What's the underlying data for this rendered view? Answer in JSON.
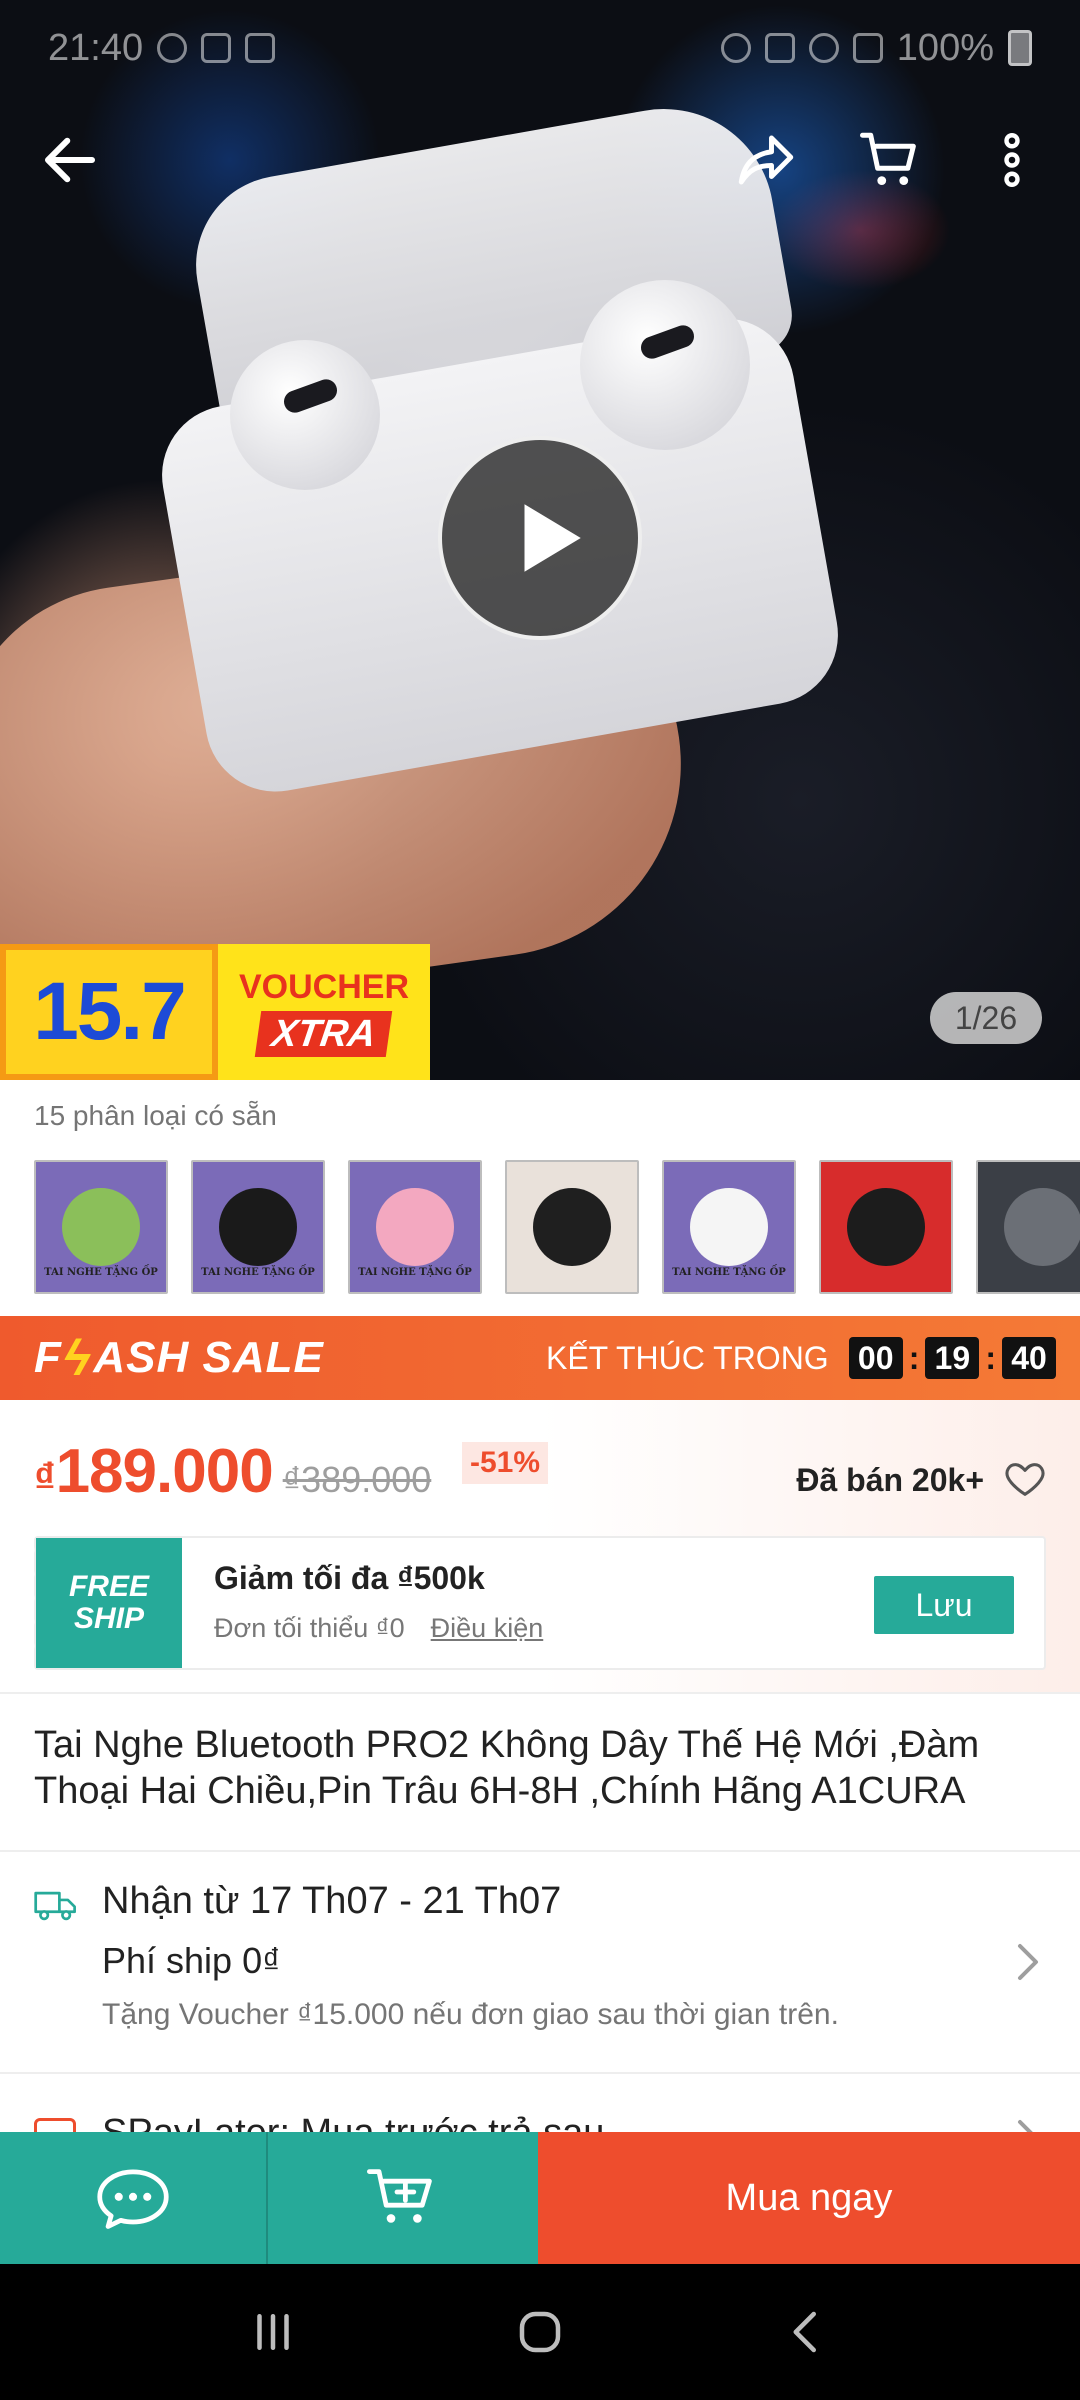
{
  "status_bar": {
    "time": "21:40",
    "battery": "100%"
  },
  "top_bar": {
    "icons": [
      "back-arrow-icon",
      "share-icon",
      "cart-icon",
      "more-vertical-icon"
    ]
  },
  "gallery": {
    "counter": "1/26"
  },
  "promo": {
    "badge_157": "15.7",
    "voucher_label": "VOUCHER",
    "xtra_label": "XTRA"
  },
  "variants": {
    "label": "15 phân loại có sẵn",
    "items": [
      {
        "caption": "TAI NGHE TẶNG ỐP",
        "bg": "#7b6bb8",
        "blob": "#8bbf5a"
      },
      {
        "caption": "TAI NGHE TẶNG ỐP",
        "bg": "#7b6bb8",
        "blob": "#1a1a1a"
      },
      {
        "caption": "TAI NGHE TẶNG ỐP",
        "bg": "#7b6bb8",
        "blob": "#f3a8c0"
      },
      {
        "caption": "",
        "bg": "#e9e1da",
        "blob": "#1f1f1f"
      },
      {
        "caption": "TAI NGHE TẶNG ỐP",
        "bg": "#7b6bb8",
        "blob": "#f5f5f5"
      },
      {
        "caption": "",
        "bg": "#d72c2c",
        "blob": "#1c1c1c"
      },
      {
        "caption": "",
        "bg": "#3b3f46",
        "blob": "#6b6f76"
      }
    ]
  },
  "flash_sale": {
    "logo_pre": "F",
    "logo_post": "ASH SALE",
    "ends_label": "KẾT THÚC TRONG",
    "hh": "00",
    "mm": "19",
    "ss": "40"
  },
  "price": {
    "currency": "₫",
    "current": "189.000",
    "original": "₫389.000",
    "discount": "-51%",
    "sold": "Đã bán 20k+"
  },
  "voucher": {
    "badge_line1": "FREE",
    "badge_line2": "SHIP",
    "title": "Giảm tối đa ₫500k",
    "min_order": "Đơn tối thiểu ₫0",
    "conditions": "Điều kiện",
    "save_label": "Lưu"
  },
  "product": {
    "title": "Tai Nghe Bluetooth PRO2 Không Dây Thế Hệ Mới ,Đàm Thoại Hai Chiều,Pin Trâu 6H-8H ,Chính Hãng A1CURA"
  },
  "shipping": {
    "eta": "Nhận từ 17 Th07 - 21 Th07",
    "fee": "Phí ship 0₫",
    "note": "Tặng Voucher ₫15.000 nếu đơn giao sau thời gian trên."
  },
  "spaylater": {
    "text": "SPayLater: Mua trước trả sau"
  },
  "action_bar": {
    "buy_now": "Mua ngay"
  },
  "colors": {
    "primary": "#ee4d2d",
    "teal": "#26aa99",
    "flash_from": "#ef5a2d",
    "flash_to": "#f47a36"
  }
}
